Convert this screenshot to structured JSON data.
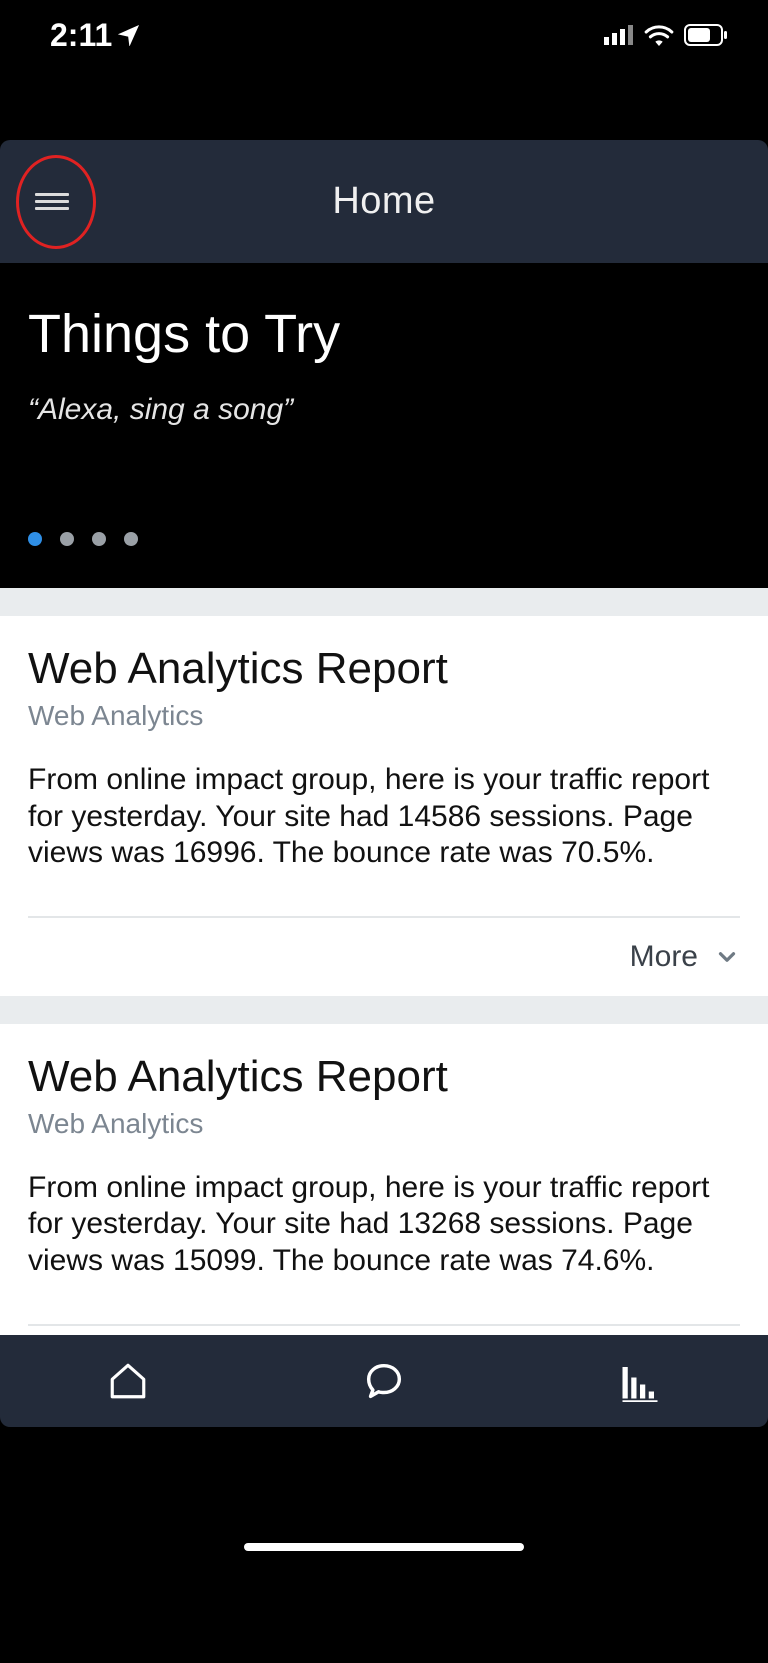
{
  "status": {
    "time": "2:11"
  },
  "header": {
    "title": "Home"
  },
  "hero": {
    "title": "Things to Try",
    "subtitle": "“Alexa, sing a song”",
    "dots_total": 4,
    "dots_active_index": 0
  },
  "cards": [
    {
      "title": "Web Analytics Report",
      "subtitle": "Web Analytics",
      "body": "From online impact group, here is your traffic report for yesterday. Your site had 14586 sessions. Page views was 16996. The bounce rate was 70.5%.",
      "more_label": "More"
    },
    {
      "title": "Web Analytics Report",
      "subtitle": "Web Analytics",
      "body": "From online impact group, here is your traffic report for yesterday. Your site had 13268 sessions. Page views was 15099. The bounce rate was 74.6%."
    }
  ]
}
